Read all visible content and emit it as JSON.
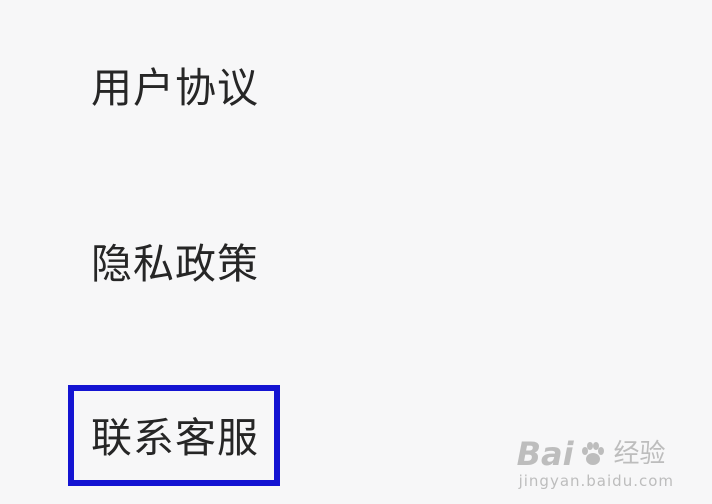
{
  "menu": {
    "items": [
      {
        "label": "用户协议"
      },
      {
        "label": "隐私政策"
      },
      {
        "label": "联系客服"
      }
    ],
    "highlighted_index": 2
  },
  "watermark": {
    "brand_left": "Bai",
    "brand_right": "经验",
    "brand_icon": "paw-icon",
    "url": "jingyan.baidu.com"
  },
  "colors": {
    "background": "#f7f7f8",
    "text": "#262626",
    "highlight": "#1414d2",
    "watermark": "#aaaaaa"
  }
}
